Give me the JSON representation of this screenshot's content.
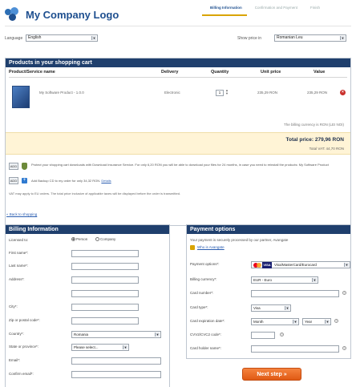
{
  "header": {
    "logo_text": "My Company Logo",
    "steps": [
      {
        "label": "Billing Information",
        "active": true
      },
      {
        "label": "Confirmation and Payment",
        "active": false
      },
      {
        "label": "Finish",
        "active": false
      }
    ]
  },
  "prefs": {
    "language_label": "Language",
    "language_value": "English",
    "price_label": "Show price in",
    "price_value": "Romanian Leu"
  },
  "cart": {
    "title": "Products in your shopping cart",
    "columns": [
      "Product/Service name",
      "Delivery",
      "Quantity",
      "Unit price",
      "Value"
    ],
    "items": [
      {
        "name": "My Software Product - 1.0.0",
        "delivery": "Electronic",
        "quantity": "1",
        "unit_price": "235,29 RON",
        "value": "235,29 RON"
      }
    ],
    "currency_note": "The billing currency is RON (LEI NOI)",
    "total_price": "Total price: 279,96 RON",
    "total_vat": "Total VAT: 44,70 RON",
    "addon1_btn": "ADD",
    "addon1_text": "Protect your shopping cart downloads with Download Insurance Service. For only 6,20 RON you will be able to download your files for 24 months, in case you need to reinstall the products: My Software Product",
    "addon2_btn": "ADD",
    "addon2_text": "Add Backup CD to my order for only 34,32 RON.",
    "addon2_link": "Details",
    "vat_note": "VAT may apply to EU orders. The total price inclusive of applicable taxes will be displayed before the order is transmitted."
  },
  "back_link": "« Back to shopping",
  "billing": {
    "title": "Billing Information",
    "licensed_label": "Licensed to:",
    "radio_person": "Person",
    "radio_company": "Company",
    "fields": [
      {
        "label": "First name*:",
        "value": ""
      },
      {
        "label": "Last name*:",
        "value": ""
      },
      {
        "label": "Address*:",
        "value": ""
      },
      {
        "label": "City*:",
        "value": ""
      },
      {
        "label": "Zip or postal code*:",
        "value": ""
      },
      {
        "label": "Country*:",
        "value": "Romania"
      },
      {
        "label": "State or province*:",
        "value": "Please select..."
      },
      {
        "label": "Email*:",
        "value": ""
      },
      {
        "label": "Confirm email*:",
        "value": ""
      }
    ]
  },
  "payment": {
    "title": "Payment options",
    "secure_note": "Your payment is securely processed by our partner, Avangate",
    "secure_link": "Who is Avangate",
    "options_label": "Payment options*:",
    "options_value": "Visa/MasterCard/Eurocard",
    "currency_label": "Billing currency*:",
    "currency_value": "EUR - Euro",
    "card_number_label": "Card number*:",
    "card_type_label": "Card type*:",
    "card_type_value": "Visa",
    "expiration_label": "Card expiration date*:",
    "month_value": "Month",
    "year_value": "Year",
    "cvv_label": "CVV2/CVC2 code*:",
    "holder_label": "Card holder name*:"
  },
  "next_button": "Next step »",
  "colors": {
    "header_bar": "#1f3f6d",
    "totals_bg": "#fff4d6",
    "next_btn": "#e8661e",
    "logo": "#1e4f8f"
  }
}
